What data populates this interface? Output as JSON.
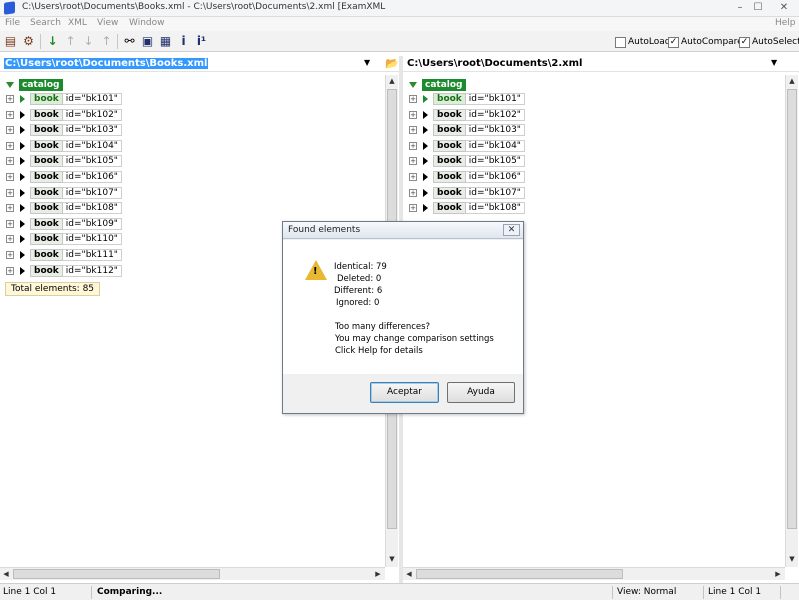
{
  "window": {
    "title": "C:\\Users\\root\\Documents\\Books.xml - C:\\Users\\root\\Documents\\2.xml [ExamXML",
    "minimize": "–",
    "maximize": "☐",
    "close": "✕"
  },
  "menu": [
    "File",
    "Search",
    "XML",
    "View",
    "Window",
    "Help"
  ],
  "toolbar": {
    "checkboxes": [
      {
        "label": "AutoLoad",
        "checked": false
      },
      {
        "label": "AutoCompare",
        "checked": true
      },
      {
        "label": "AutoSelect",
        "checked": true
      }
    ]
  },
  "left": {
    "path": "C:\\Users\\root\\Documents\\Books.xml",
    "root_tag": "catalog",
    "rows": [
      {
        "tag": "book",
        "attr": "id=\"bk101\"",
        "highlight": true
      },
      {
        "tag": "book",
        "attr": "id=\"bk102\"",
        "highlight": false
      },
      {
        "tag": "book",
        "attr": "id=\"bk103\"",
        "highlight": false
      },
      {
        "tag": "book",
        "attr": "id=\"bk104\"",
        "highlight": false
      },
      {
        "tag": "book",
        "attr": "id=\"bk105\"",
        "highlight": false
      },
      {
        "tag": "book",
        "attr": "id=\"bk106\"",
        "highlight": false
      },
      {
        "tag": "book",
        "attr": "id=\"bk107\"",
        "highlight": false
      },
      {
        "tag": "book",
        "attr": "id=\"bk108\"",
        "highlight": false
      },
      {
        "tag": "book",
        "attr": "id=\"bk109\"",
        "highlight": false
      },
      {
        "tag": "book",
        "attr": "id=\"bk110\"",
        "highlight": false
      },
      {
        "tag": "book",
        "attr": "id=\"bk111\"",
        "highlight": false
      },
      {
        "tag": "book",
        "attr": "id=\"bk112\"",
        "highlight": false
      }
    ],
    "total": "Total elements: 85"
  },
  "right": {
    "path": "C:\\Users\\root\\Documents\\2.xml",
    "root_tag": "catalog",
    "rows": [
      {
        "tag": "book",
        "attr": "id=\"bk101\"",
        "highlight": true
      },
      {
        "tag": "book",
        "attr": "id=\"bk102\"",
        "highlight": false
      },
      {
        "tag": "book",
        "attr": "id=\"bk103\"",
        "highlight": false
      },
      {
        "tag": "book",
        "attr": "id=\"bk104\"",
        "highlight": false
      },
      {
        "tag": "book",
        "attr": "id=\"bk105\"",
        "highlight": false
      },
      {
        "tag": "book",
        "attr": "id=\"bk106\"",
        "highlight": false
      },
      {
        "tag": "book",
        "attr": "id=\"bk107\"",
        "highlight": false
      },
      {
        "tag": "book",
        "attr": "id=\"bk108\"",
        "highlight": false
      }
    ]
  },
  "dialog": {
    "title": "Found elements",
    "close": "✕",
    "identical": "Identical:  79",
    "deleted": "Deleted:   0",
    "different": "Different: 6",
    "ignored": "Ignored:   0",
    "msg1": "Too many differences?",
    "msg2": "You may change comparison settings",
    "msg3": "Click Help for details",
    "ok": "Aceptar",
    "help": "Ayuda"
  },
  "status": {
    "pos_left": "Line 1  Col 1",
    "state": "Comparing...",
    "view": "View: Normal",
    "pos_right": "Line 1  Col 1"
  },
  "colors": {
    "accent": "#1d8a2e",
    "path_highlight": "#3399ff"
  }
}
